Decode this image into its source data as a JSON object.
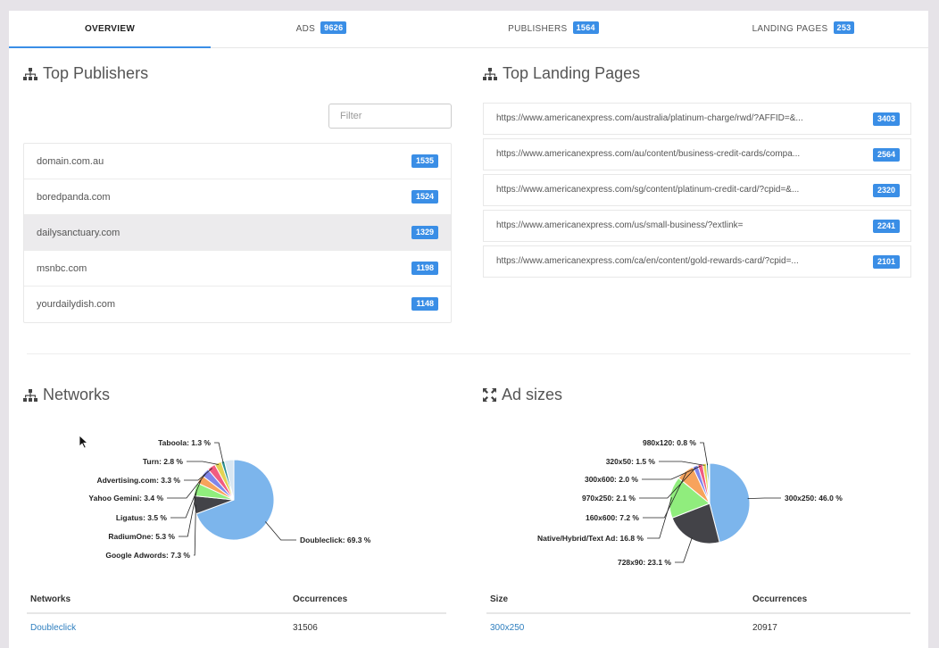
{
  "tabs": [
    {
      "label": "OVERVIEW",
      "badge": ""
    },
    {
      "label": "ADS",
      "badge": "9626"
    },
    {
      "label": "PUBLISHERS",
      "badge": "1564"
    },
    {
      "label": "LANDING PAGES",
      "badge": "253"
    }
  ],
  "publishers": {
    "title": "Top Publishers",
    "filter_placeholder": "Filter",
    "items": [
      {
        "name": "domain.com.au",
        "count": "1535"
      },
      {
        "name": "boredpanda.com",
        "count": "1524"
      },
      {
        "name": "dailysanctuary.com",
        "count": "1329"
      },
      {
        "name": "msnbc.com",
        "count": "1198"
      },
      {
        "name": "yourdailydish.com",
        "count": "1148"
      }
    ]
  },
  "landing_pages": {
    "title": "Top Landing Pages",
    "items": [
      {
        "url": "https://www.americanexpress.com/australia/platinum-charge/rwd/?AFFID=&...",
        "count": "3403"
      },
      {
        "url": "https://www.americanexpress.com/au/content/business-credit-cards/compa...",
        "count": "2564"
      },
      {
        "url": "https://www.americanexpress.com/sg/content/platinum-credit-card/?cpid=&...",
        "count": "2320"
      },
      {
        "url": "https://www.americanexpress.com/us/small-business/?extlink=",
        "count": "2241"
      },
      {
        "url": "https://www.americanexpress.com/ca/en/content/gold-rewards-card/?cpid=...",
        "count": "2101"
      }
    ]
  },
  "networks": {
    "title": "Networks",
    "table": {
      "col1": "Networks",
      "col2": "Occurrences",
      "row_name": "Doubleclick",
      "row_value": "31506"
    }
  },
  "ad_sizes": {
    "title": "Ad sizes",
    "table": {
      "col1": "Size",
      "col2": "Occurrences",
      "row_name": "300x250",
      "row_value": "20917"
    }
  },
  "chart_data": [
    {
      "type": "pie",
      "title": "",
      "slices": [
        {
          "label": "Doubleclick: 69.3 %",
          "value": 69.3,
          "color": "#7cb5ec"
        },
        {
          "label": "Google Adwords: 7.3 %",
          "value": 7.3,
          "color": "#434348"
        },
        {
          "label": "RadiumOne: 5.3 %",
          "value": 5.3,
          "color": "#90ed7d"
        },
        {
          "label": "Ligatus: 3.5 %",
          "value": 3.5,
          "color": "#f7a35c"
        },
        {
          "label": "Yahoo Gemini: 3.4 %",
          "value": 3.4,
          "color": "#8085e9"
        },
        {
          "label": "Advertising.com: 3.3 %",
          "value": 3.3,
          "color": "#f15c80"
        },
        {
          "label": "Turn: 2.8 %",
          "value": 2.8,
          "color": "#e4d354"
        },
        {
          "label": "Taboola: 1.3 %",
          "value": 1.3,
          "color": "#2b908f"
        },
        {
          "label": "",
          "value": 3.8,
          "color": "#d8e6f2"
        }
      ]
    },
    {
      "type": "pie",
      "title": "",
      "slices": [
        {
          "label": "300x250: 46.0 %",
          "value": 46.0,
          "color": "#7cb5ec"
        },
        {
          "label": "728x90: 23.1 %",
          "value": 23.1,
          "color": "#434348"
        },
        {
          "label": "Native/Hybrid/Text Ad: 16.8 %",
          "value": 16.8,
          "color": "#90ed7d"
        },
        {
          "label": "160x600: 7.2 %",
          "value": 7.2,
          "color": "#f7a35c"
        },
        {
          "label": "970x250: 2.1 %",
          "value": 2.1,
          "color": "#8085e9"
        },
        {
          "label": "300x600: 2.0 %",
          "value": 2.0,
          "color": "#f15c80"
        },
        {
          "label": "320x50: 1.5 %",
          "value": 1.5,
          "color": "#e4d354"
        },
        {
          "label": "980x120: 0.8 %",
          "value": 0.8,
          "color": "#2b908f"
        },
        {
          "label": "",
          "value": 0.5,
          "color": "#d8e6f2"
        }
      ]
    }
  ]
}
